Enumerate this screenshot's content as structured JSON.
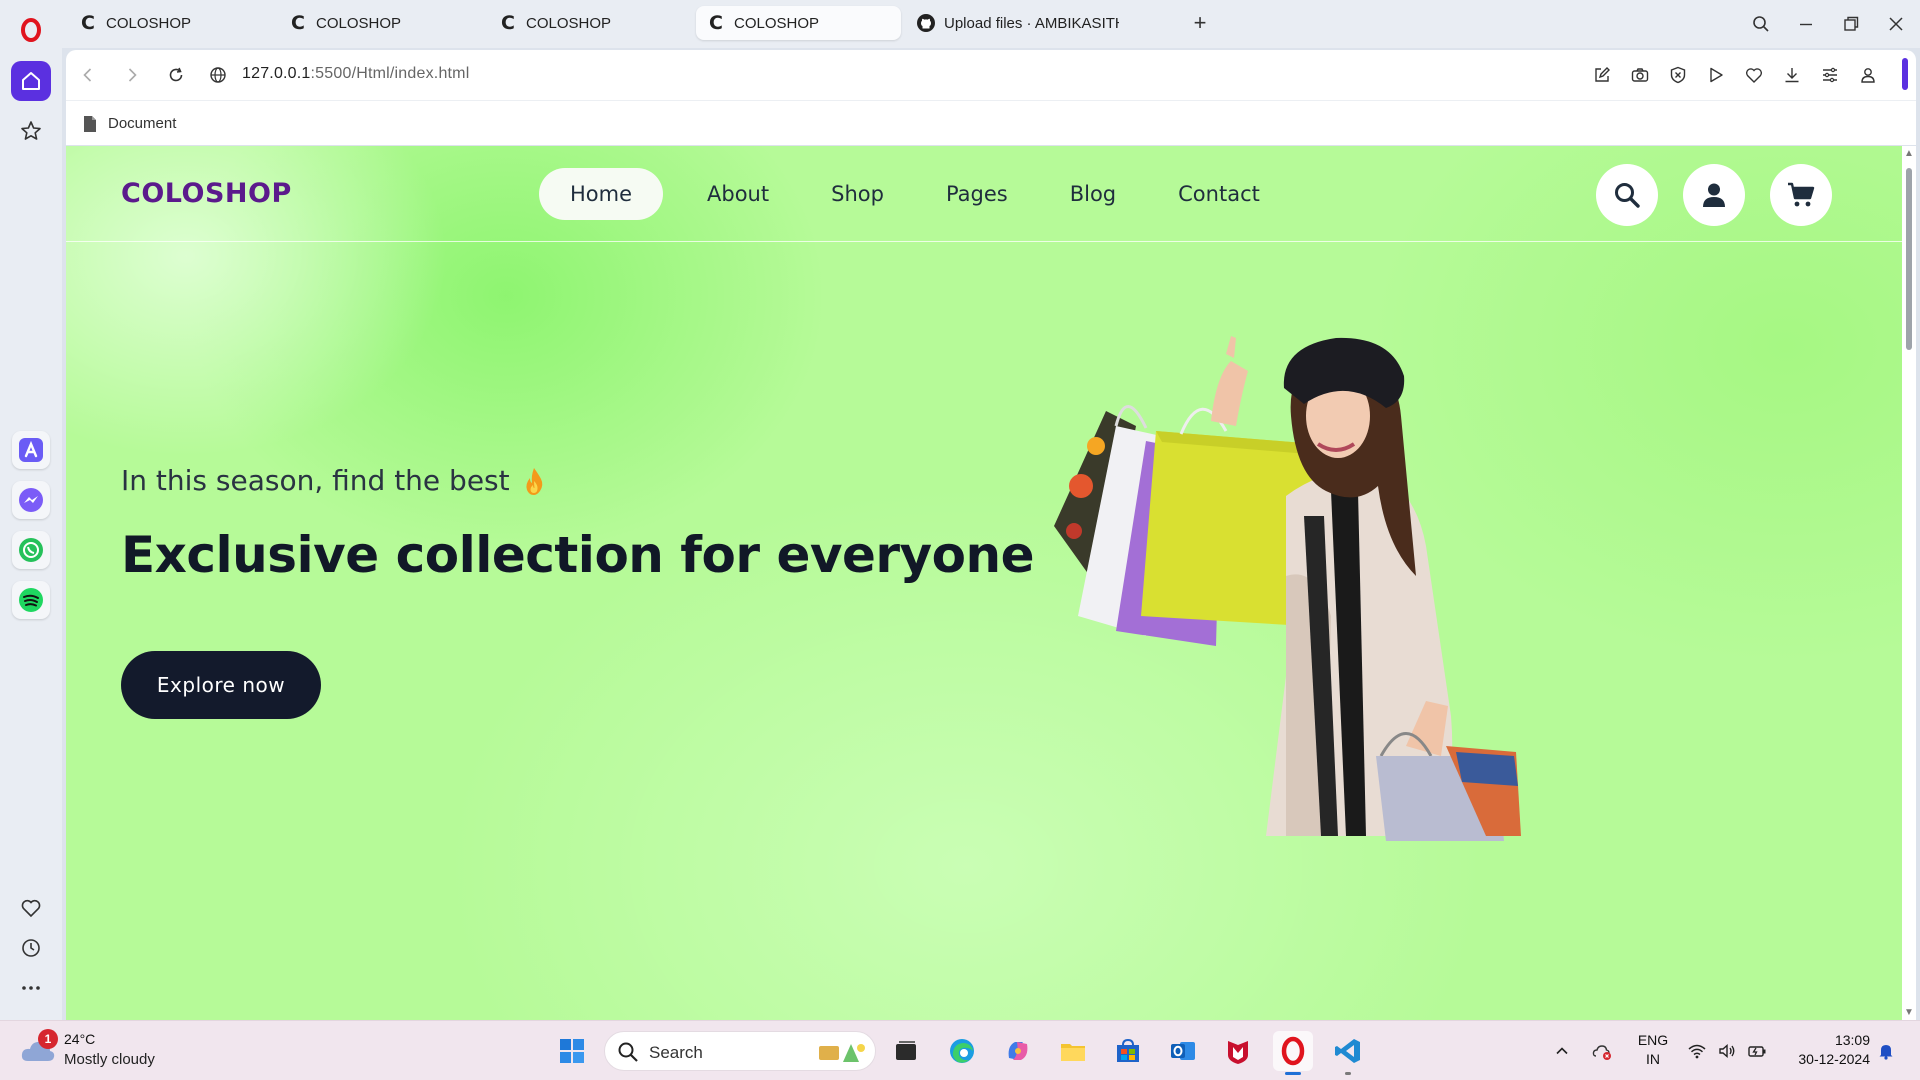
{
  "browser": {
    "tabs": [
      {
        "title": "COLOSHOP",
        "favicon": "C",
        "active": false
      },
      {
        "title": "COLOSHOP",
        "favicon": "C",
        "active": false
      },
      {
        "title": "COLOSHOP",
        "favicon": "C",
        "active": false
      },
      {
        "title": "COLOSHOP",
        "favicon": "C",
        "active": true
      },
      {
        "title": "Upload files · AMBIKASITH",
        "favicon": "github-icon",
        "active": false
      }
    ],
    "new_tab_label": "+",
    "url_host": "127.0.0.1",
    "url_rest": ":5500/Html/index.html",
    "bookmark": "Document"
  },
  "site": {
    "logo": "COLOSHOP",
    "nav": [
      "Home",
      "About",
      "Shop",
      "Pages",
      "Blog",
      "Contact"
    ],
    "active_nav": "Home",
    "hero": {
      "kicker": "In this season, find the best",
      "headline": "Exclusive collection for everyone",
      "cta": "Explore now"
    }
  },
  "taskbar": {
    "weather_badge": "1",
    "temperature": "24°C",
    "condition": "Mostly cloudy",
    "search_label": "Search",
    "lang_line1": "ENG",
    "lang_line2": "IN",
    "time": "13:09",
    "date": "30-12-2024"
  },
  "colors": {
    "page_bg": "#b6fa98",
    "logo": "#5b1a8c",
    "cta_bg": "#131a2c",
    "opera_red": "#e0141e",
    "opera_accent": "#5b30e0"
  }
}
